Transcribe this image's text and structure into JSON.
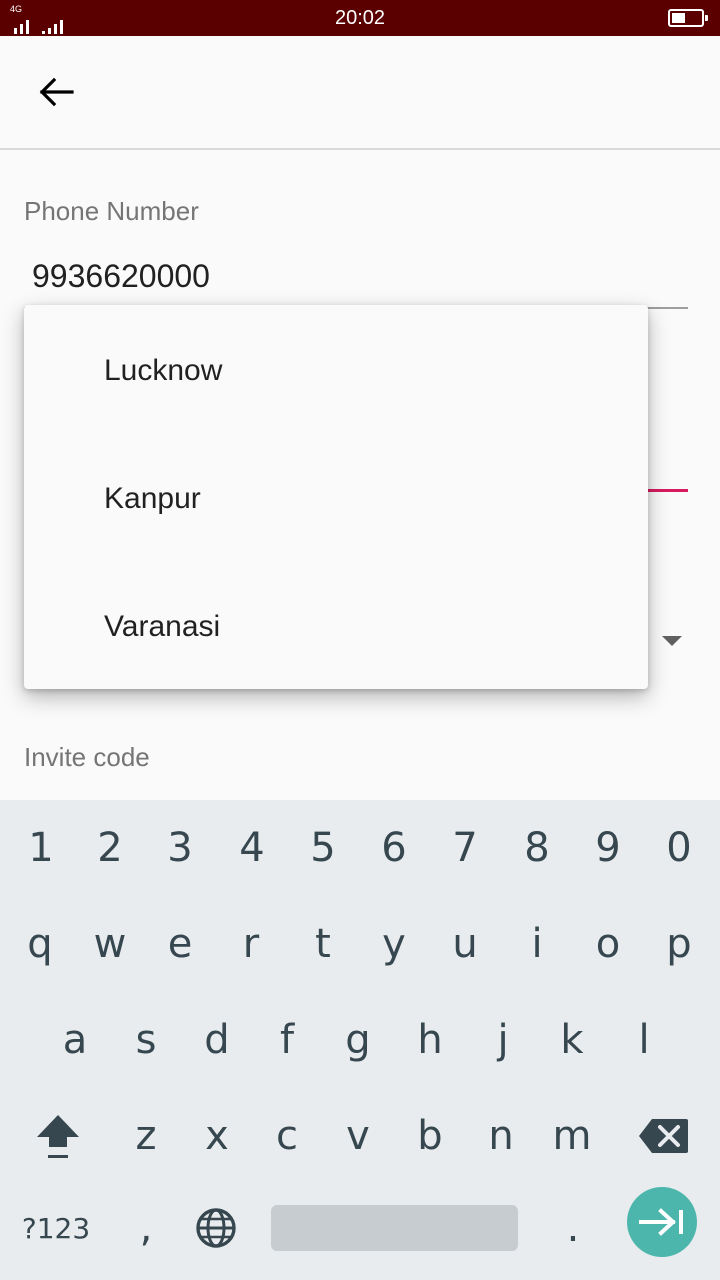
{
  "status_bar": {
    "network": "4G",
    "time": "20:02",
    "battery_level": 0.45
  },
  "app_bar": {
    "back_icon": "arrow-left-icon"
  },
  "form": {
    "phone_label": "Phone Number",
    "phone_value": "9936620000",
    "invite_label": "Invite code"
  },
  "dropdown": {
    "options": [
      "Lucknow",
      "Kanpur",
      "Varanasi"
    ]
  },
  "colors": {
    "status_bar": "#5a0000",
    "accent": "#d81b60",
    "enter_key": "#4db6ac"
  },
  "keyboard": {
    "numbers": [
      "1",
      "2",
      "3",
      "4",
      "5",
      "6",
      "7",
      "8",
      "9",
      "0"
    ],
    "row1": [
      "q",
      "w",
      "e",
      "r",
      "t",
      "y",
      "u",
      "i",
      "o",
      "p"
    ],
    "row2": [
      "a",
      "s",
      "d",
      "f",
      "g",
      "h",
      "j",
      "k",
      "l"
    ],
    "row3": [
      "z",
      "x",
      "c",
      "v",
      "b",
      "n",
      "m"
    ],
    "symbols_key": "?123",
    "comma_key": ",",
    "period_key": ".",
    "shift_icon": "shift-icon",
    "backspace_icon": "backspace-icon",
    "globe_icon": "globe-icon",
    "enter_icon": "enter-icon"
  }
}
